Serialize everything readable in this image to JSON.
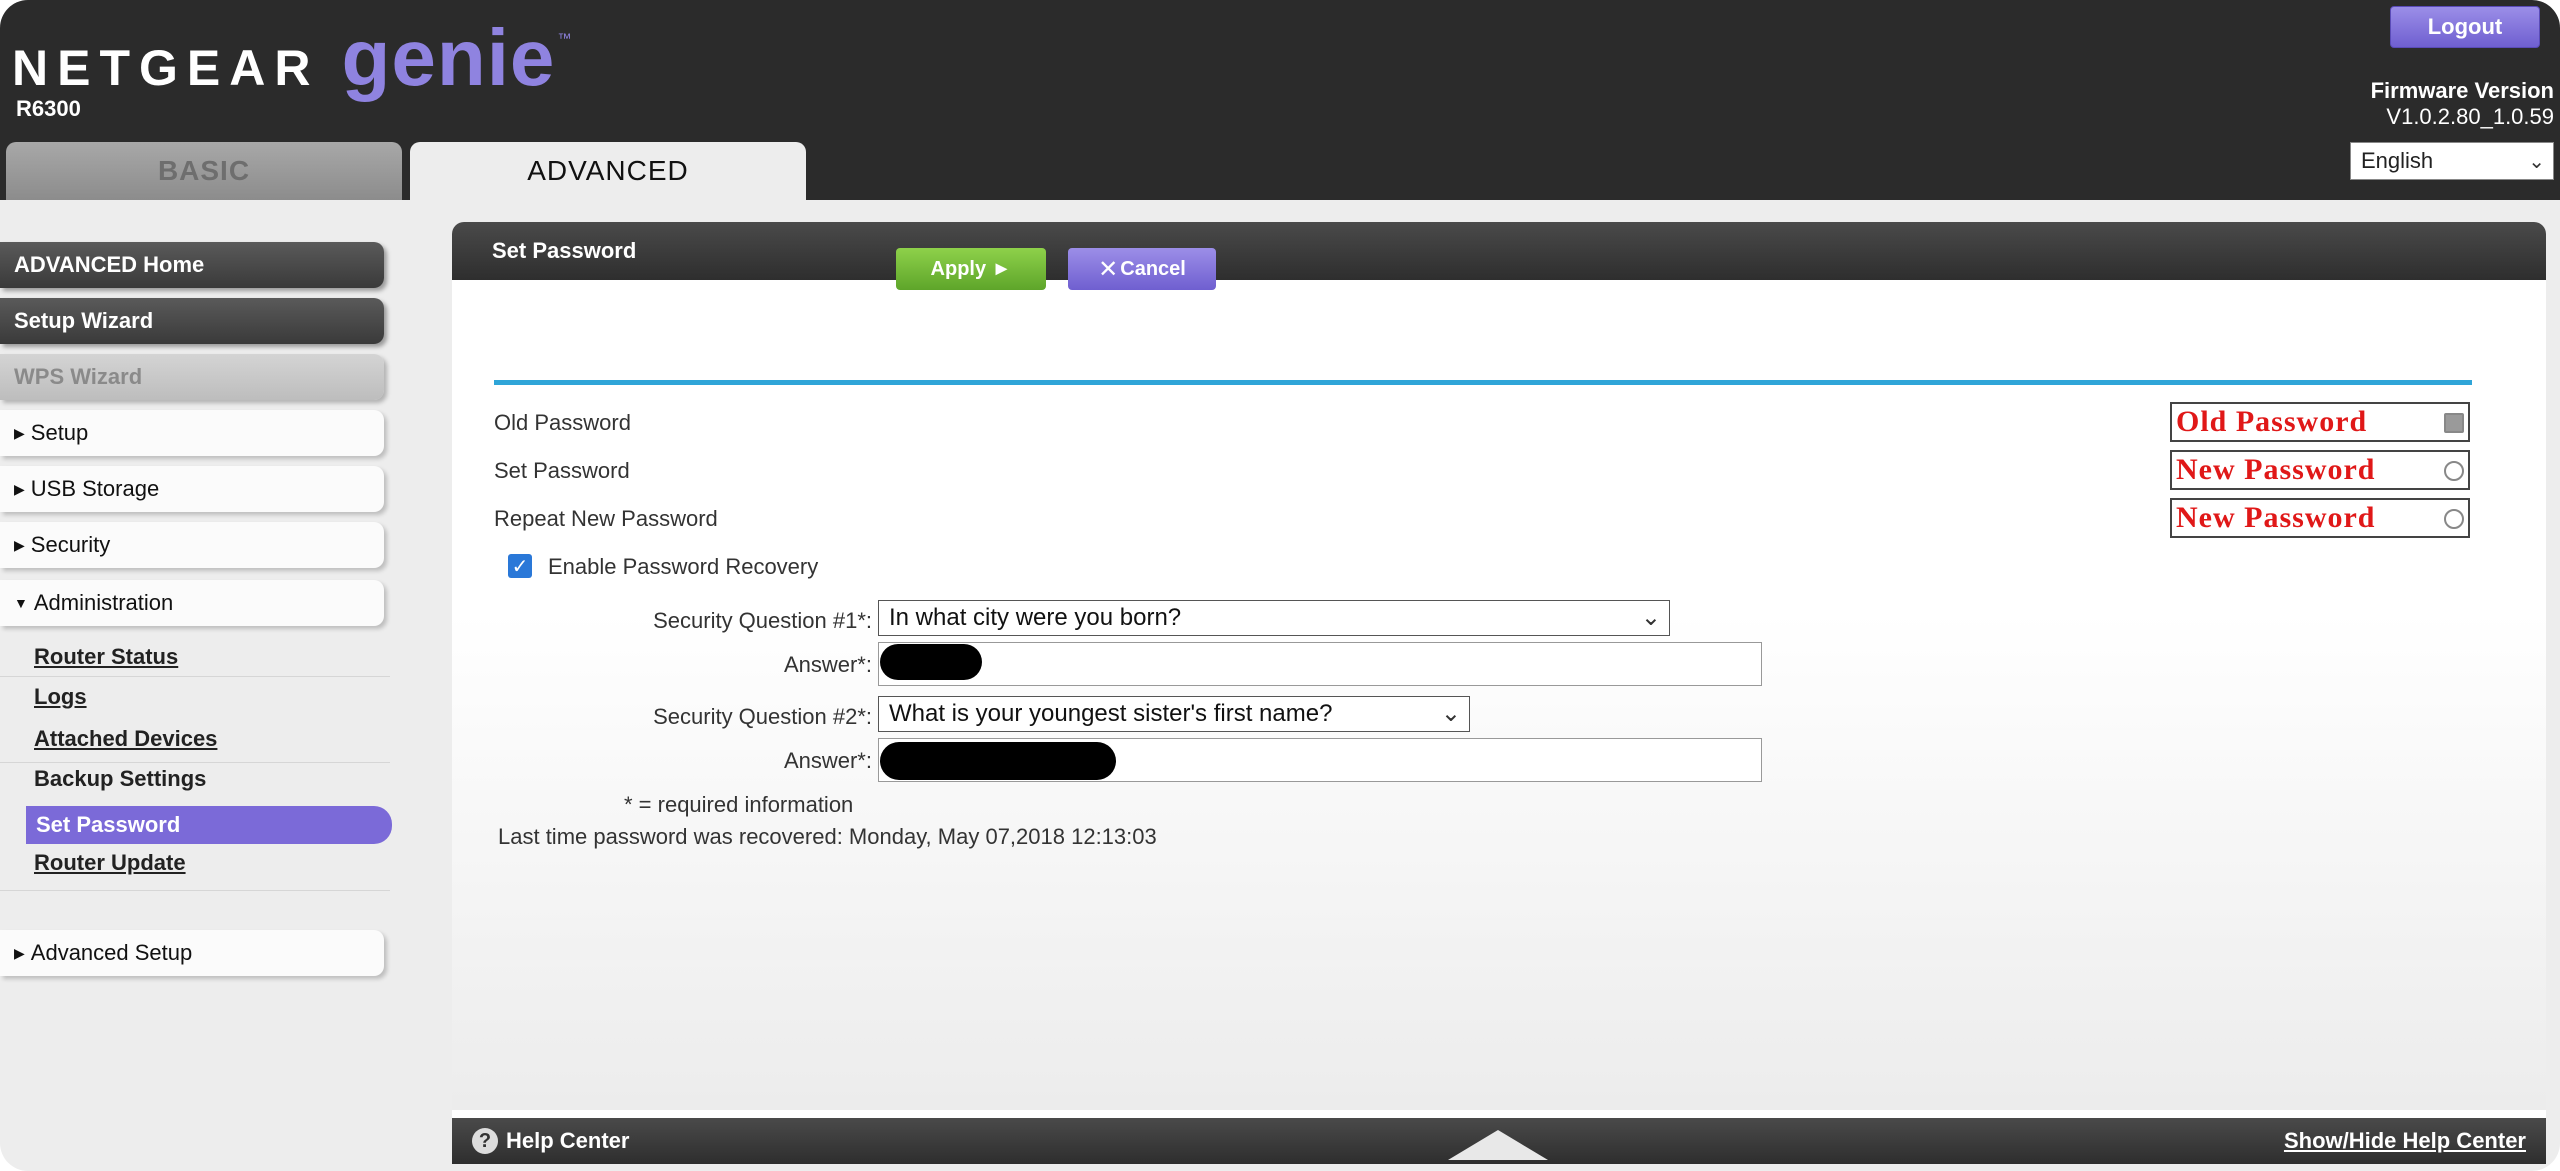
{
  "header": {
    "brand_netgear": "NETGEAR",
    "brand_genie": "genie",
    "brand_tm": "™",
    "model": "R6300",
    "logout_label": "Logout",
    "firmware_label": "Firmware Version",
    "firmware_value": "V1.0.2.80_1.0.59",
    "language": "English",
    "tabs": [
      {
        "label": "BASIC",
        "active": false
      },
      {
        "label": "ADVANCED",
        "active": true
      }
    ]
  },
  "sidebar": {
    "advanced_home": "ADVANCED Home",
    "setup_wizard": "Setup Wizard",
    "wps_wizard": "WPS Wizard",
    "setup": "Setup",
    "usb_storage": "USB Storage",
    "security": "Security",
    "administration": "Administration",
    "admin_items": {
      "router_status": "Router Status",
      "logs": "Logs",
      "attached_devices": "Attached Devices",
      "backup_settings": "Backup Settings",
      "set_password": "Set Password",
      "router_update": "Router Update"
    },
    "advanced_setup": "Advanced Setup"
  },
  "panel": {
    "title": "Set Password",
    "apply_label": "Apply ►",
    "cancel_label": "Cancel",
    "old_password_label": "Old Password",
    "set_password_label": "Set Password",
    "repeat_password_label": "Repeat New Password",
    "old_password_value": "Old Password",
    "new_password_value": "New Password",
    "repeat_password_value": "New Password",
    "enable_recovery_label": "Enable Password Recovery",
    "enable_recovery_checked": true,
    "question1_label": "Security Question #1*:",
    "question1_value": "In what city were you born?",
    "answer1_label": "Answer*:",
    "question2_label": "Security Question #2*:",
    "question2_value": "What is your youngest sister's first name?",
    "answer2_label": "Answer*:",
    "required_note": "* = required information",
    "last_recovered": "Last time password was recovered: Monday, May 07,2018 12:13:03"
  },
  "help": {
    "help_center": "Help Center",
    "show_hide": "Show/Hide Help Center"
  },
  "colors": {
    "accent_purple": "#7b6ad8",
    "apply_green": "#6cb732",
    "rule_blue": "#2fa5d8",
    "password_red": "#e01818"
  }
}
